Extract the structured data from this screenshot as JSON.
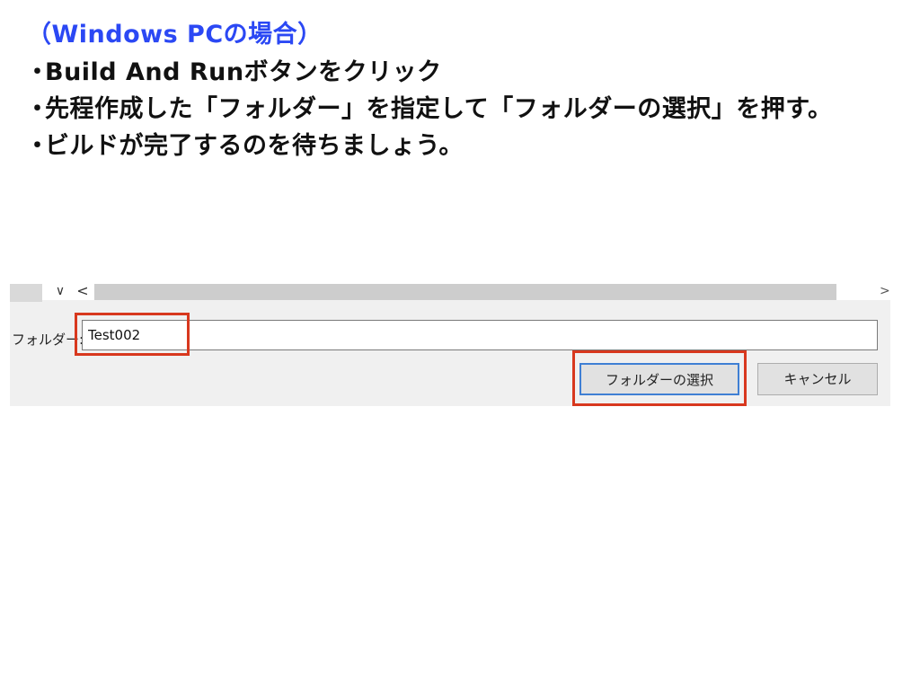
{
  "slide": {
    "heading": "（Windows PCの場合）",
    "bullet_marker": "・",
    "bullets": [
      "Build And Runボタンをクリック",
      "先程作成した「フォルダー」を指定して「フォルダーの選択」を押す。",
      "ビルドが完了するのを待ちましょう。"
    ],
    "heading_color": "#2b48f4",
    "highlight_color": "#d8381e"
  },
  "dialog": {
    "dropdown_glyph": "∨",
    "scroll_left_glyph": "<",
    "scroll_right_glyph": ">",
    "folder_label": "フォルダー:",
    "folder_value": "Test002",
    "select_button_label": "フォルダーの選択",
    "cancel_button_label": "キャンセル"
  }
}
